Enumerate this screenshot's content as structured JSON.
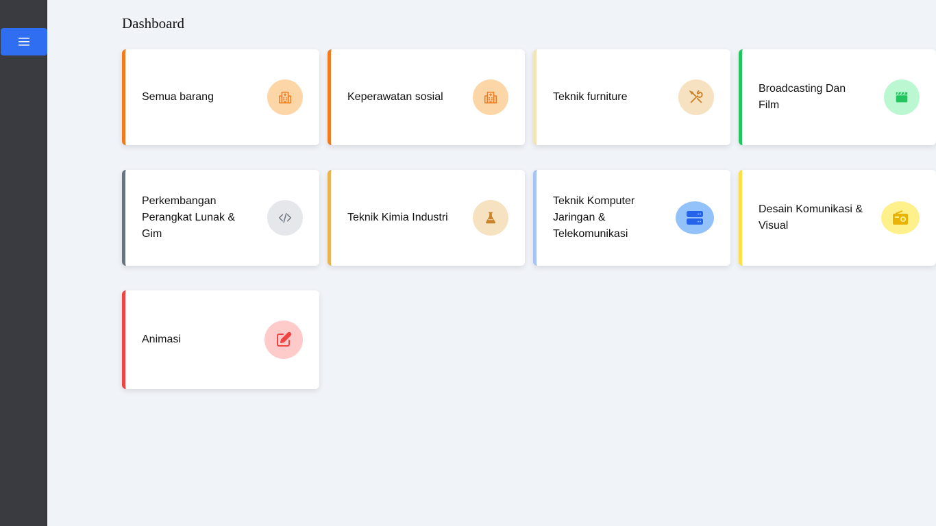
{
  "page": {
    "title": "Dashboard"
  },
  "sidebar": {
    "menu_icon": "hamburger-menu-icon"
  },
  "colors": {
    "sidebar_bg": "#393b41",
    "menu_button": "#2f6ef0",
    "page_bg": "#f0f3f8"
  },
  "cards": [
    {
      "label": "Semua barang",
      "icon": "building-icon",
      "accent": "#f07a1e",
      "icon_bg": "#fdd6a8",
      "icon_color": "#f07a1e"
    },
    {
      "label": "Keperawatan sosial",
      "icon": "building-icon",
      "accent": "#f07a1e",
      "icon_bg": "#fdd6a8",
      "icon_color": "#f07a1e"
    },
    {
      "label": "Teknik furniture",
      "icon": "tools-icon",
      "accent": "#f5e3b8",
      "icon_bg": "#f6e2c0",
      "icon_color": "#c9822a"
    },
    {
      "label": "Broadcasting Dan Film",
      "icon": "clapperboard-icon",
      "accent": "#22c55e",
      "icon_bg": "#bbf7d0",
      "icon_color": "#22c55e"
    },
    {
      "label": "Perkembangan Perangkat Lunak & Gim",
      "icon": "code-icon",
      "accent": "#6b7280",
      "icon_bg": "#e5e7eb",
      "icon_color": "#6b7280"
    },
    {
      "label": "Teknik Kimia Industri",
      "icon": "flask-icon",
      "accent": "#eab34f",
      "icon_bg": "#f6e2c0",
      "icon_color": "#c9822a"
    },
    {
      "label": "Teknik Komputer Jaringan & Telekomunikasi",
      "icon": "server-icon",
      "accent": "#a5c4f5",
      "icon_bg": "#93c2fb",
      "icon_color": "#2563eb"
    },
    {
      "label": "Desain Komunikasi & Visual",
      "icon": "radio-icon",
      "accent": "#fde047",
      "icon_bg": "#fef08a",
      "icon_color": "#eab308"
    },
    {
      "label": "Animasi",
      "icon": "edit-icon",
      "accent": "#ef4444",
      "icon_bg": "#fecaca",
      "icon_color": "#ef4444"
    }
  ]
}
